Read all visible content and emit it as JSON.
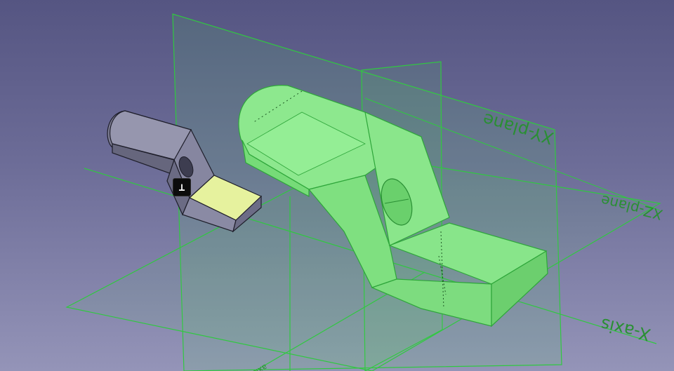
{
  "viewport": {
    "background_top": "#555582",
    "background_bottom": "#9494b8",
    "selection_color": "#7cf07c",
    "plane_line_color": "#2fc73f",
    "part_color": "#8e8ea8",
    "selected_face_color": "#e8f3a0"
  },
  "labels": {
    "xy_plane": "XY-plane",
    "xz_plane": "XZ-plane",
    "x_axis": "X-axis",
    "small_axis": "axis"
  },
  "constraint_badge": {
    "icon": "pin-constraint-icon",
    "glyph": "⊥"
  }
}
